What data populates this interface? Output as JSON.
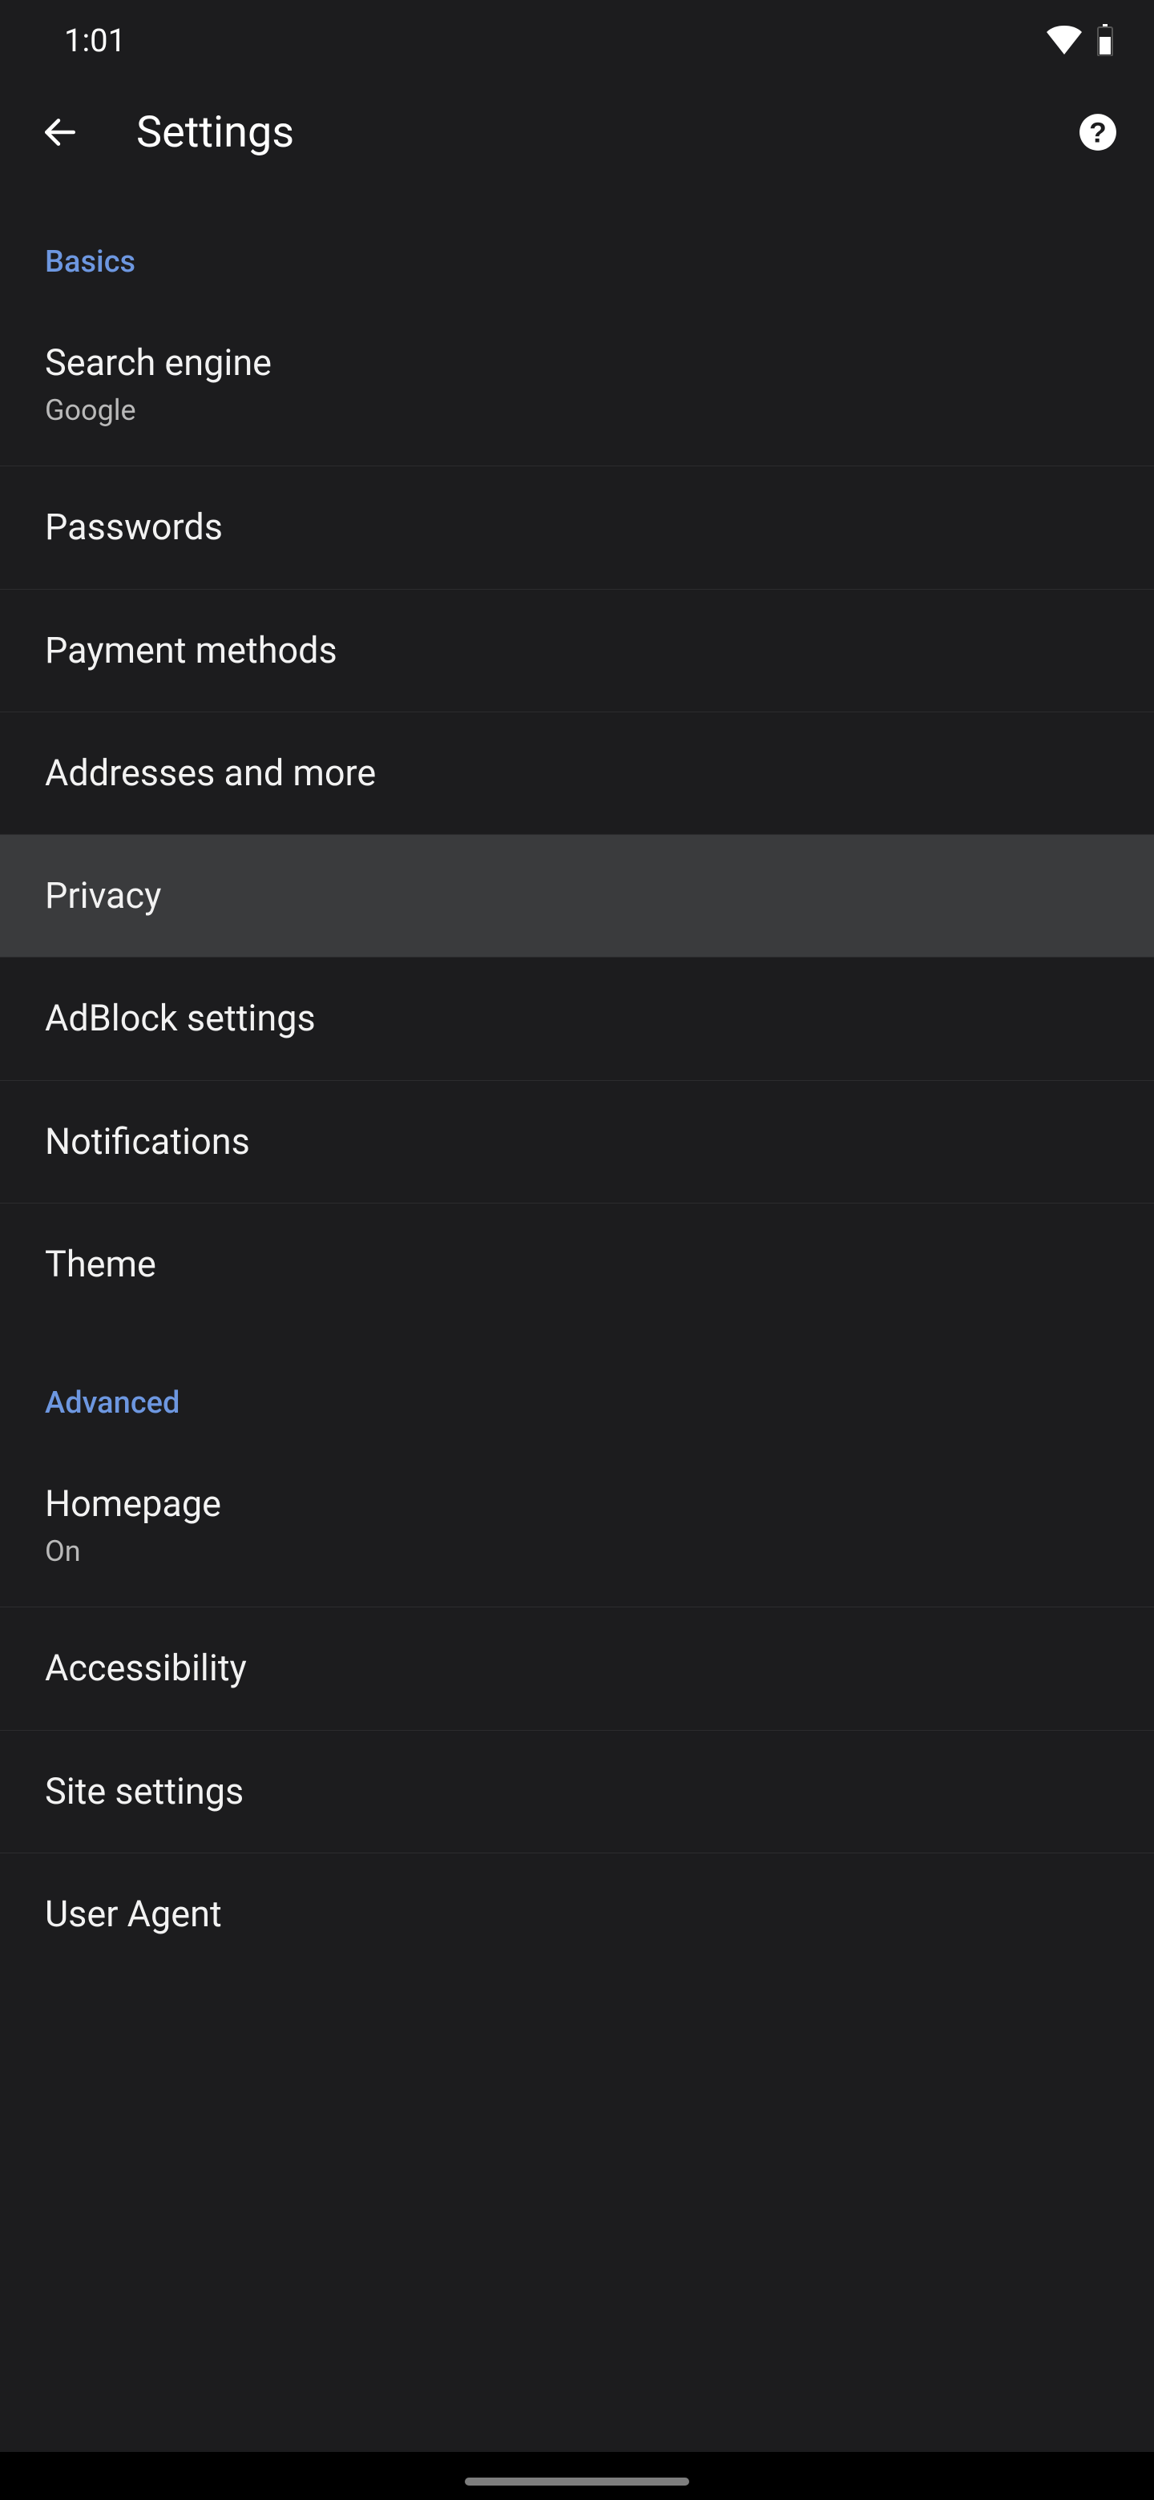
{
  "status": {
    "time": "1:01"
  },
  "header": {
    "title": "Settings"
  },
  "sections": {
    "basics": {
      "label": "Basics",
      "items": {
        "search_engine": {
          "title": "Search engine",
          "sub": "Google"
        },
        "passwords": {
          "title": "Passwords"
        },
        "payment": {
          "title": "Payment methods"
        },
        "addresses": {
          "title": "Addresses and more"
        },
        "privacy": {
          "title": "Privacy"
        },
        "adblock": {
          "title": "AdBlock settings"
        },
        "notifications": {
          "title": "Notifications"
        },
        "theme": {
          "title": "Theme"
        }
      }
    },
    "advanced": {
      "label": "Advanced",
      "items": {
        "homepage": {
          "title": "Homepage",
          "sub": "On"
        },
        "accessibility": {
          "title": "Accessibility"
        },
        "site_settings": {
          "title": "Site settings"
        },
        "user_agent": {
          "title": "User Agent"
        }
      }
    }
  }
}
